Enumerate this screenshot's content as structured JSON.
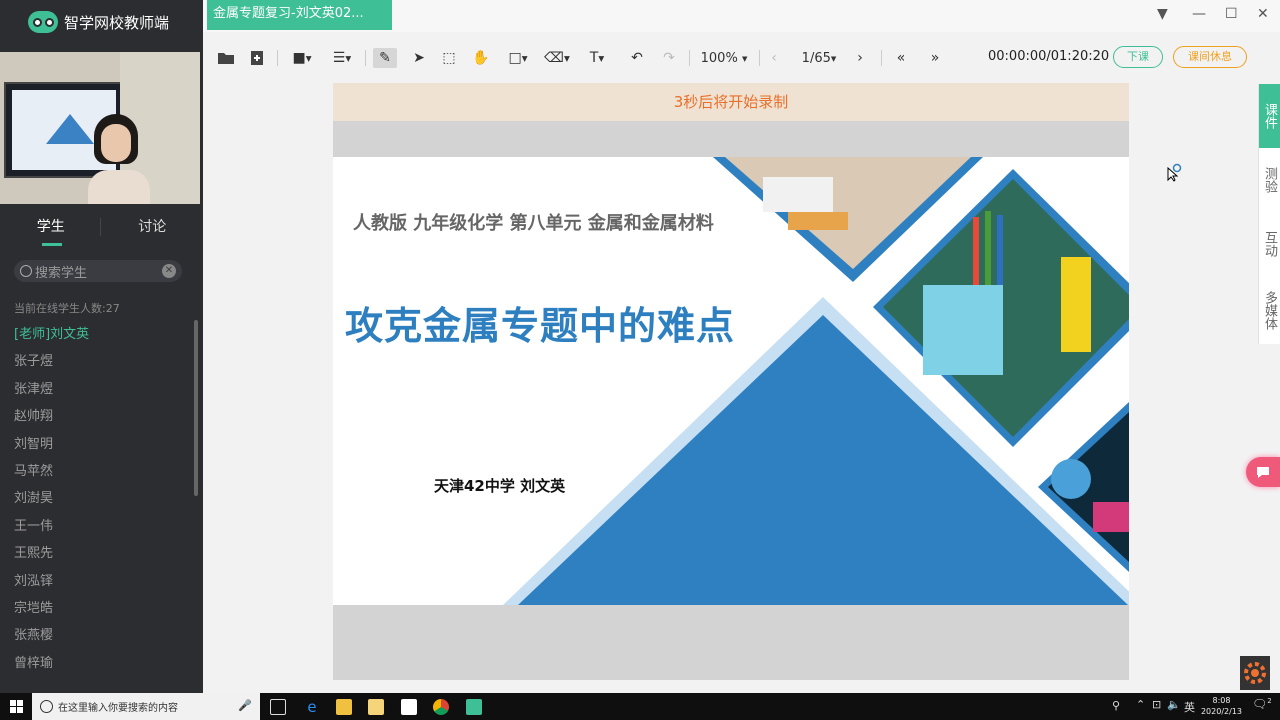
{
  "app": {
    "title": "智学网校教师端"
  },
  "doc_tab": {
    "label": "金属专题复习-刘文英02..."
  },
  "sidebar": {
    "tabs": [
      "学生",
      "讨论"
    ],
    "search_placeholder": "搜索学生",
    "online_count": "当前在线学生人数:27",
    "students": [
      "[老师]刘文英",
      "张子煜",
      "张津煜",
      "赵帅翔",
      "刘智明",
      "马苹然",
      "刘澍昊",
      "王一伟",
      "王熙先",
      "刘泓铎",
      "宗垲皓",
      "张燕樱",
      "曾梓瑜"
    ]
  },
  "toolbar": {
    "zoom": "100%",
    "page": "1/65",
    "timer": "00:00:00/01:20:20",
    "end_class": "下课",
    "break": "课间休息"
  },
  "slide": {
    "record_notice": "3秒后将开始录制",
    "subtitle": "人教版 九年级化学 第八单元 金属和金属材料",
    "title": "攻克金属专题中的难点",
    "author": "天津42中学 刘文英"
  },
  "rail": [
    "课件",
    "测验",
    "互动",
    "多媒体"
  ],
  "taskbar": {
    "search_placeholder": "在这里输入你要搜索的内容",
    "ime": "英",
    "time": "8:08",
    "date": "2020/2/13",
    "notifications": "2"
  },
  "colors": {
    "accent": "#3fbf96",
    "title_blue": "#2d7fc0",
    "notice_orange": "#e8702a"
  }
}
